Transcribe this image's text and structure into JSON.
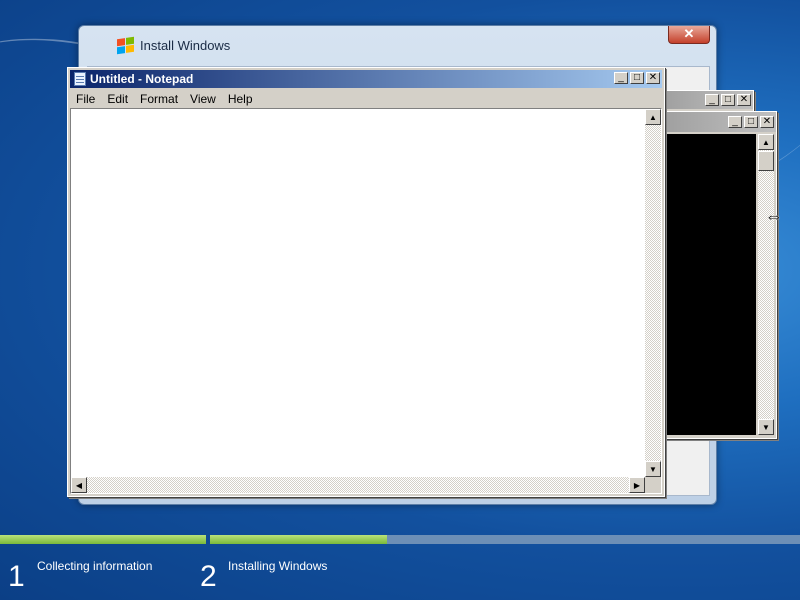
{
  "desktop": {
    "accent": "#1f6fc0"
  },
  "install_window": {
    "title": "Install Windows",
    "close_label": "✕"
  },
  "notepad": {
    "title": "Untitled - Notepad",
    "menu": [
      "File",
      "Edit",
      "Format",
      "View",
      "Help"
    ],
    "content": ""
  },
  "window_buttons": {
    "minimize": "_",
    "maximize": "□",
    "close": "✕"
  },
  "progress": {
    "steps": [
      {
        "number": "1",
        "label": "Collecting information",
        "progress": 1.0
      },
      {
        "number": "2",
        "label": "Installing Windows",
        "progress": 0.3
      }
    ],
    "colors": {
      "track": "#6d8fb6",
      "fill": "#7ab93a"
    }
  },
  "cursor": {
    "icon": "resize-horizontal-icon",
    "glyph": "⇔"
  }
}
